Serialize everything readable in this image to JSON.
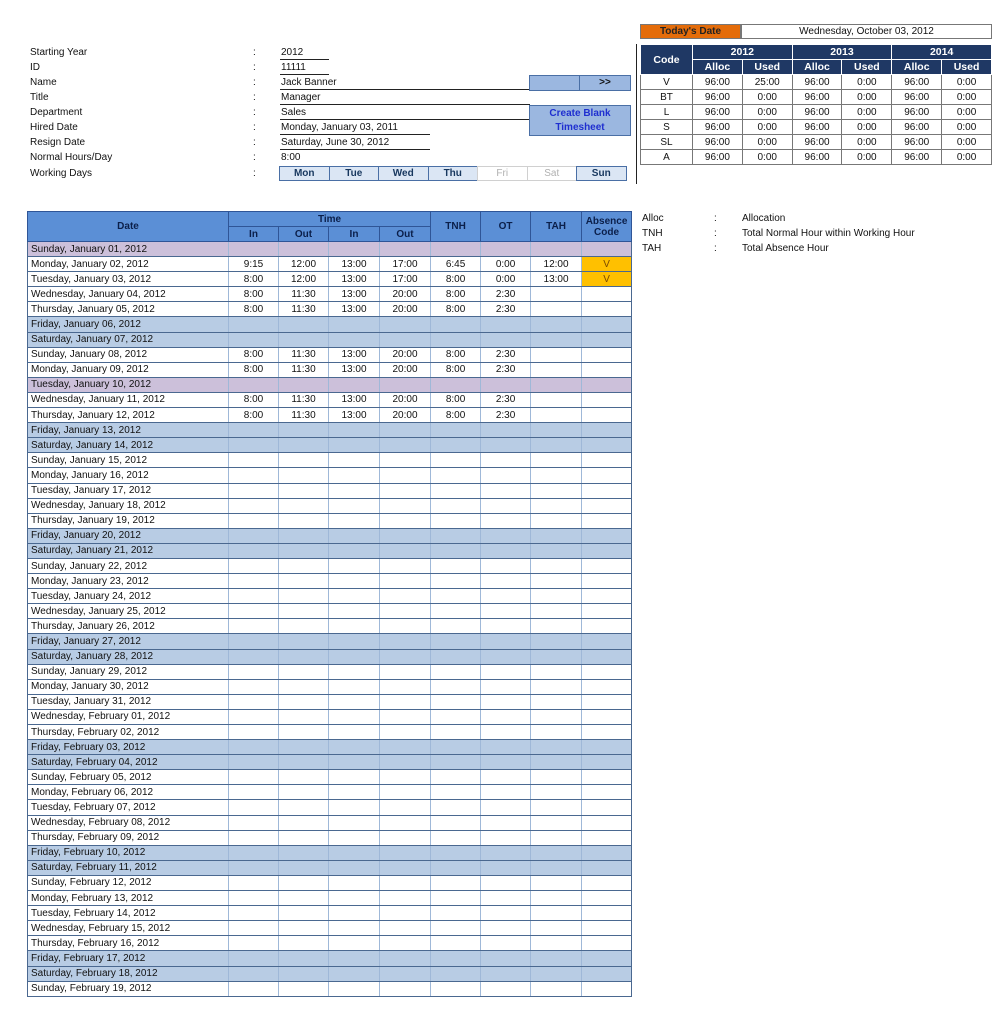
{
  "employee": {
    "fields": [
      {
        "label": "Starting Year",
        "value": "2012"
      },
      {
        "label": "ID",
        "value": "11111"
      },
      {
        "label": "Name",
        "value": "Jack Banner"
      },
      {
        "label": "Title",
        "value": "Manager"
      },
      {
        "label": "Department",
        "value": "Sales"
      },
      {
        "label": "Hired Date",
        "value": "Monday, January 03, 2011"
      },
      {
        "label": "Resign Date",
        "value": "Saturday, June 30, 2012"
      },
      {
        "label": "Normal Hours/Day",
        "value": "8:00"
      },
      {
        "label": "Working Days",
        "value": ""
      }
    ],
    "colon": ":",
    "working_days": [
      {
        "label": "Mon",
        "active": true
      },
      {
        "label": "Tue",
        "active": true
      },
      {
        "label": "Wed",
        "active": true
      },
      {
        "label": "Thu",
        "active": true
      },
      {
        "label": "Fri",
        "active": false
      },
      {
        "label": "Sat",
        "active": false
      },
      {
        "label": "Sun",
        "active": true
      }
    ]
  },
  "buttons": {
    "next": ">>",
    "create_blank_line1": "Create Blank",
    "create_blank_line2": "Timesheet"
  },
  "today": {
    "label": "Today's Date",
    "value": "Wednesday, October 03, 2012"
  },
  "allocation": {
    "code_header": "Code",
    "years": [
      "2012",
      "2013",
      "2014"
    ],
    "sub_headers": [
      "Alloc",
      "Used"
    ],
    "rows": [
      {
        "code": "V",
        "values": [
          "96:00",
          "25:00",
          "96:00",
          "0:00",
          "96:00",
          "0:00"
        ]
      },
      {
        "code": "BT",
        "values": [
          "96:00",
          "0:00",
          "96:00",
          "0:00",
          "96:00",
          "0:00"
        ]
      },
      {
        "code": "L",
        "values": [
          "96:00",
          "0:00",
          "96:00",
          "0:00",
          "96:00",
          "0:00"
        ]
      },
      {
        "code": "S",
        "values": [
          "96:00",
          "0:00",
          "96:00",
          "0:00",
          "96:00",
          "0:00"
        ]
      },
      {
        "code": "SL",
        "values": [
          "96:00",
          "0:00",
          "96:00",
          "0:00",
          "96:00",
          "0:00"
        ]
      },
      {
        "code": "A",
        "values": [
          "96:00",
          "0:00",
          "96:00",
          "0:00",
          "96:00",
          "0:00"
        ]
      }
    ]
  },
  "legend": [
    {
      "key": "Alloc",
      "sep": ":",
      "desc": "Allocation"
    },
    {
      "key": "TNH",
      "sep": ":",
      "desc": "Total Normal Hour within Working Hour"
    },
    {
      "key": "TAH",
      "sep": ":",
      "desc": "Total Absence Hour"
    }
  ],
  "timesheet": {
    "headers": {
      "date": "Date",
      "time": "Time",
      "time_sub": [
        "In",
        "Out",
        "In",
        "Out"
      ],
      "tnh": "TNH",
      "ot": "OT",
      "tah": "TAH",
      "absence_line1": "Absence",
      "absence_line2": "Code"
    },
    "colors": {
      "weekend": "#b8cce4",
      "holiday": "#ccc0da",
      "absence": "#ffc000"
    },
    "rows": [
      {
        "date": "Sunday, January 01, 2012",
        "type": "holiday",
        "cells": [
          "",
          "",
          "",
          "",
          "",
          "",
          "",
          ""
        ]
      },
      {
        "date": "Monday, January 02, 2012",
        "type": "work",
        "cells": [
          "9:15",
          "12:00",
          "13:00",
          "17:00",
          "6:45",
          "0:00",
          "12:00",
          "V"
        ]
      },
      {
        "date": "Tuesday, January 03, 2012",
        "type": "work",
        "cells": [
          "8:00",
          "12:00",
          "13:00",
          "17:00",
          "8:00",
          "0:00",
          "13:00",
          "V"
        ]
      },
      {
        "date": "Wednesday, January 04, 2012",
        "type": "work",
        "cells": [
          "8:00",
          "11:30",
          "13:00",
          "20:00",
          "8:00",
          "2:30",
          "",
          ""
        ]
      },
      {
        "date": "Thursday, January 05, 2012",
        "type": "work",
        "cells": [
          "8:00",
          "11:30",
          "13:00",
          "20:00",
          "8:00",
          "2:30",
          "",
          ""
        ]
      },
      {
        "date": "Friday, January 06, 2012",
        "type": "weekend",
        "cells": [
          "",
          "",
          "",
          "",
          "",
          "",
          "",
          ""
        ]
      },
      {
        "date": "Saturday, January 07, 2012",
        "type": "weekend",
        "cells": [
          "",
          "",
          "",
          "",
          "",
          "",
          "",
          ""
        ]
      },
      {
        "date": "Sunday, January 08, 2012",
        "type": "work",
        "cells": [
          "8:00",
          "11:30",
          "13:00",
          "20:00",
          "8:00",
          "2:30",
          "",
          ""
        ]
      },
      {
        "date": "Monday, January 09, 2012",
        "type": "work",
        "cells": [
          "8:00",
          "11:30",
          "13:00",
          "20:00",
          "8:00",
          "2:30",
          "",
          ""
        ]
      },
      {
        "date": "Tuesday, January 10, 2012",
        "type": "holiday",
        "cells": [
          "",
          "",
          "",
          "",
          "",
          "",
          "",
          ""
        ]
      },
      {
        "date": "Wednesday, January 11, 2012",
        "type": "work",
        "cells": [
          "8:00",
          "11:30",
          "13:00",
          "20:00",
          "8:00",
          "2:30",
          "",
          ""
        ]
      },
      {
        "date": "Thursday, January 12, 2012",
        "type": "work",
        "cells": [
          "8:00",
          "11:30",
          "13:00",
          "20:00",
          "8:00",
          "2:30",
          "",
          ""
        ]
      },
      {
        "date": "Friday, January 13, 2012",
        "type": "weekend",
        "cells": [
          "",
          "",
          "",
          "",
          "",
          "",
          "",
          ""
        ]
      },
      {
        "date": "Saturday, January 14, 2012",
        "type": "weekend",
        "cells": [
          "",
          "",
          "",
          "",
          "",
          "",
          "",
          ""
        ]
      },
      {
        "date": "Sunday, January 15, 2012",
        "type": "work",
        "cells": [
          "",
          "",
          "",
          "",
          "",
          "",
          "",
          ""
        ]
      },
      {
        "date": "Monday, January 16, 2012",
        "type": "work",
        "cells": [
          "",
          "",
          "",
          "",
          "",
          "",
          "",
          ""
        ]
      },
      {
        "date": "Tuesday, January 17, 2012",
        "type": "work",
        "cells": [
          "",
          "",
          "",
          "",
          "",
          "",
          "",
          ""
        ]
      },
      {
        "date": "Wednesday, January 18, 2012",
        "type": "work",
        "cells": [
          "",
          "",
          "",
          "",
          "",
          "",
          "",
          ""
        ]
      },
      {
        "date": "Thursday, January 19, 2012",
        "type": "work",
        "cells": [
          "",
          "",
          "",
          "",
          "",
          "",
          "",
          ""
        ]
      },
      {
        "date": "Friday, January 20, 2012",
        "type": "weekend",
        "cells": [
          "",
          "",
          "",
          "",
          "",
          "",
          "",
          ""
        ]
      },
      {
        "date": "Saturday, January 21, 2012",
        "type": "weekend",
        "cells": [
          "",
          "",
          "",
          "",
          "",
          "",
          "",
          ""
        ]
      },
      {
        "date": "Sunday, January 22, 2012",
        "type": "work",
        "cells": [
          "",
          "",
          "",
          "",
          "",
          "",
          "",
          ""
        ]
      },
      {
        "date": "Monday, January 23, 2012",
        "type": "work",
        "cells": [
          "",
          "",
          "",
          "",
          "",
          "",
          "",
          ""
        ]
      },
      {
        "date": "Tuesday, January 24, 2012",
        "type": "work",
        "cells": [
          "",
          "",
          "",
          "",
          "",
          "",
          "",
          ""
        ]
      },
      {
        "date": "Wednesday, January 25, 2012",
        "type": "work",
        "cells": [
          "",
          "",
          "",
          "",
          "",
          "",
          "",
          ""
        ]
      },
      {
        "date": "Thursday, January 26, 2012",
        "type": "work",
        "cells": [
          "",
          "",
          "",
          "",
          "",
          "",
          "",
          ""
        ]
      },
      {
        "date": "Friday, January 27, 2012",
        "type": "weekend",
        "cells": [
          "",
          "",
          "",
          "",
          "",
          "",
          "",
          ""
        ]
      },
      {
        "date": "Saturday, January 28, 2012",
        "type": "weekend",
        "cells": [
          "",
          "",
          "",
          "",
          "",
          "",
          "",
          ""
        ]
      },
      {
        "date": "Sunday, January 29, 2012",
        "type": "work",
        "cells": [
          "",
          "",
          "",
          "",
          "",
          "",
          "",
          ""
        ]
      },
      {
        "date": "Monday, January 30, 2012",
        "type": "work",
        "cells": [
          "",
          "",
          "",
          "",
          "",
          "",
          "",
          ""
        ]
      },
      {
        "date": "Tuesday, January 31, 2012",
        "type": "work",
        "cells": [
          "",
          "",
          "",
          "",
          "",
          "",
          "",
          ""
        ]
      },
      {
        "date": "Wednesday, February 01, 2012",
        "type": "work",
        "cells": [
          "",
          "",
          "",
          "",
          "",
          "",
          "",
          ""
        ]
      },
      {
        "date": "Thursday, February 02, 2012",
        "type": "work",
        "cells": [
          "",
          "",
          "",
          "",
          "",
          "",
          "",
          ""
        ]
      },
      {
        "date": "Friday, February 03, 2012",
        "type": "weekend",
        "cells": [
          "",
          "",
          "",
          "",
          "",
          "",
          "",
          ""
        ]
      },
      {
        "date": "Saturday, February 04, 2012",
        "type": "weekend",
        "cells": [
          "",
          "",
          "",
          "",
          "",
          "",
          "",
          ""
        ]
      },
      {
        "date": "Sunday, February 05, 2012",
        "type": "work",
        "cells": [
          "",
          "",
          "",
          "",
          "",
          "",
          "",
          ""
        ]
      },
      {
        "date": "Monday, February 06, 2012",
        "type": "work",
        "cells": [
          "",
          "",
          "",
          "",
          "",
          "",
          "",
          ""
        ]
      },
      {
        "date": "Tuesday, February 07, 2012",
        "type": "work",
        "cells": [
          "",
          "",
          "",
          "",
          "",
          "",
          "",
          ""
        ]
      },
      {
        "date": "Wednesday, February 08, 2012",
        "type": "work",
        "cells": [
          "",
          "",
          "",
          "",
          "",
          "",
          "",
          ""
        ]
      },
      {
        "date": "Thursday, February 09, 2012",
        "type": "work",
        "cells": [
          "",
          "",
          "",
          "",
          "",
          "",
          "",
          ""
        ]
      },
      {
        "date": "Friday, February 10, 2012",
        "type": "weekend",
        "cells": [
          "",
          "",
          "",
          "",
          "",
          "",
          "",
          ""
        ]
      },
      {
        "date": "Saturday, February 11, 2012",
        "type": "weekend",
        "cells": [
          "",
          "",
          "",
          "",
          "",
          "",
          "",
          ""
        ]
      },
      {
        "date": "Sunday, February 12, 2012",
        "type": "work",
        "cells": [
          "",
          "",
          "",
          "",
          "",
          "",
          "",
          ""
        ]
      },
      {
        "date": "Monday, February 13, 2012",
        "type": "work",
        "cells": [
          "",
          "",
          "",
          "",
          "",
          "",
          "",
          ""
        ]
      },
      {
        "date": "Tuesday, February 14, 2012",
        "type": "work",
        "cells": [
          "",
          "",
          "",
          "",
          "",
          "",
          "",
          ""
        ]
      },
      {
        "date": "Wednesday, February 15, 2012",
        "type": "work",
        "cells": [
          "",
          "",
          "",
          "",
          "",
          "",
          "",
          ""
        ]
      },
      {
        "date": "Thursday, February 16, 2012",
        "type": "work",
        "cells": [
          "",
          "",
          "",
          "",
          "",
          "",
          "",
          ""
        ]
      },
      {
        "date": "Friday, February 17, 2012",
        "type": "weekend",
        "cells": [
          "",
          "",
          "",
          "",
          "",
          "",
          "",
          ""
        ]
      },
      {
        "date": "Saturday, February 18, 2012",
        "type": "weekend",
        "cells": [
          "",
          "",
          "",
          "",
          "",
          "",
          "",
          ""
        ]
      },
      {
        "date": "Sunday, February 19, 2012",
        "type": "work",
        "cells": [
          "",
          "",
          "",
          "",
          "",
          "",
          "",
          ""
        ]
      }
    ]
  }
}
